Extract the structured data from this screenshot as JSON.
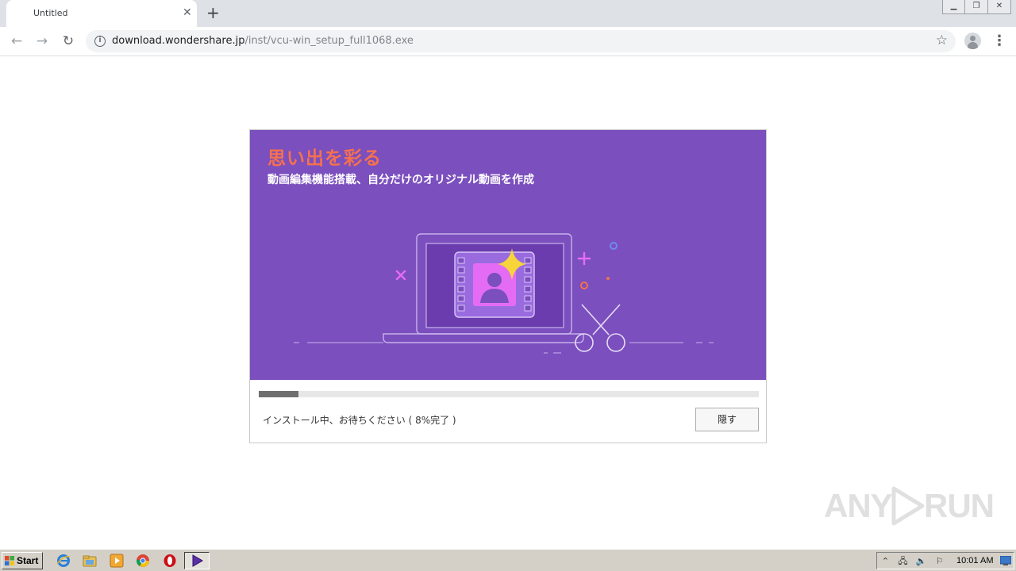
{
  "browser": {
    "tab_title": "Untitled",
    "tab_close": "✕",
    "new_tab": "+",
    "url_host": "download.wondershare.jp",
    "url_path": "/inst/vcu-win_setup_full1068.exe"
  },
  "installer": {
    "headline": "思い出を彩る",
    "subline": "動画編集機能搭載、自分だけのオリジナル動画を作成",
    "progress_percent": 8,
    "status_text": "インストール中、お待ちください ( 8%完了 )",
    "hide_button": "隠す",
    "colors": {
      "banner": "#7b4fbd",
      "headline": "#f5704f",
      "accent_pink": "#e46cf5",
      "sparkle": "#f7d53a"
    }
  },
  "watermark": {
    "left": "ANY",
    "right": "RUN"
  },
  "taskbar": {
    "start_label": "Start",
    "clock": "10:01 AM",
    "icons": [
      "ie-icon",
      "explorer-icon",
      "media-player-icon",
      "chrome-icon",
      "opera-icon",
      "installer-icon"
    ]
  }
}
